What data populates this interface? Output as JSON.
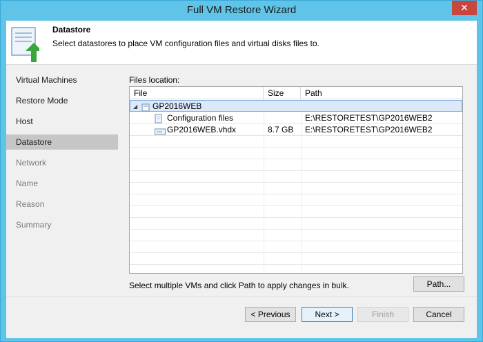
{
  "window": {
    "title": "Full VM Restore Wizard",
    "close_label": "✕"
  },
  "header": {
    "title": "Datastore",
    "description": "Select datastores to place VM configuration files and virtual disks files to."
  },
  "sidebar": {
    "items": [
      {
        "label": "Virtual Machines",
        "state": "normal"
      },
      {
        "label": "Restore Mode",
        "state": "normal"
      },
      {
        "label": "Host",
        "state": "normal"
      },
      {
        "label": "Datastore",
        "state": "active"
      },
      {
        "label": "Network",
        "state": "disabled"
      },
      {
        "label": "Name",
        "state": "disabled"
      },
      {
        "label": "Reason",
        "state": "disabled"
      },
      {
        "label": "Summary",
        "state": "disabled"
      }
    ]
  },
  "main": {
    "files_location_label": "Files location:",
    "columns": [
      "File",
      "Size",
      "Path"
    ],
    "rows": [
      {
        "file": "GP2016WEB",
        "size": "",
        "path": ""
      },
      {
        "file": "Configuration files",
        "size": "",
        "path": "E:\\RESTORETEST\\GP2016WEB2"
      },
      {
        "file": "GP2016WEB.vhdx",
        "size": "8.7 GB",
        "path": "E:\\RESTORETEST\\GP2016WEB2"
      }
    ],
    "hint": "Select multiple VMs and click Path to apply changes in bulk.",
    "path_button": "Path..."
  },
  "footer": {
    "previous": "< Previous",
    "next": "Next >",
    "finish": "Finish",
    "cancel": "Cancel"
  },
  "colors": {
    "titlebar": "#5fc4e8",
    "close": "#c7463e",
    "arrow_green": "#3aa53a"
  }
}
